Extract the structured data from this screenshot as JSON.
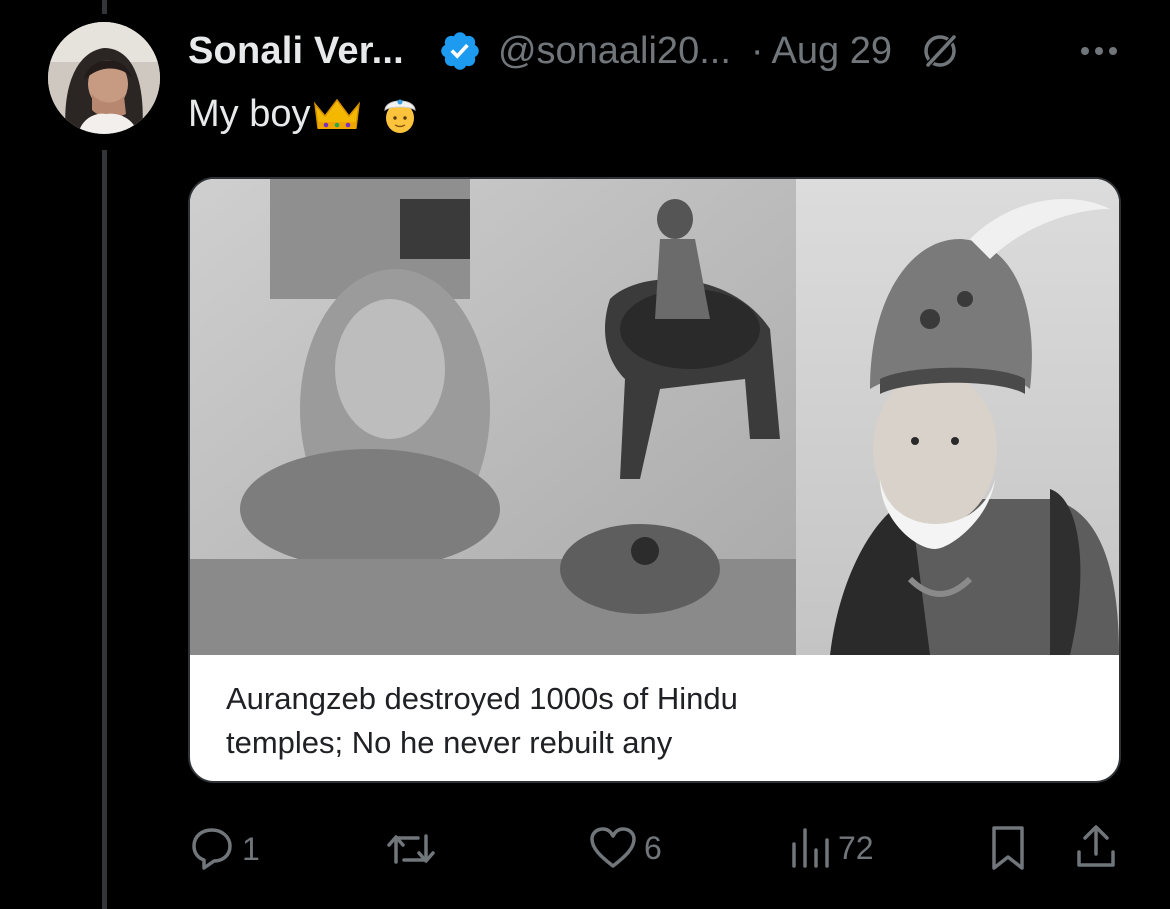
{
  "post": {
    "author_name": "Sonali Ver...",
    "handle": "@sonaali20...",
    "separator": "·",
    "date": "Aug 29",
    "text": "My boy"
  },
  "media": {
    "caption_line1": "Aurangzeb destroyed 1000s of Hindu",
    "caption_line2": "temples; No he never rebuilt any"
  },
  "actions": {
    "replies": "1",
    "reposts": "",
    "likes": "6",
    "views": "72"
  },
  "icons": {
    "verified": "verified-badge-icon",
    "grok": "grok-icon",
    "more": "more-icon",
    "reply": "reply-icon",
    "repost": "repost-icon",
    "like": "heart-icon",
    "views": "views-icon",
    "bookmark": "bookmark-icon",
    "share": "share-icon"
  },
  "colors": {
    "background": "#000000",
    "text_primary": "#e7e9ea",
    "text_secondary": "#71767b",
    "verified_blue": "#1d9bf0",
    "thread_line": "#333639"
  }
}
